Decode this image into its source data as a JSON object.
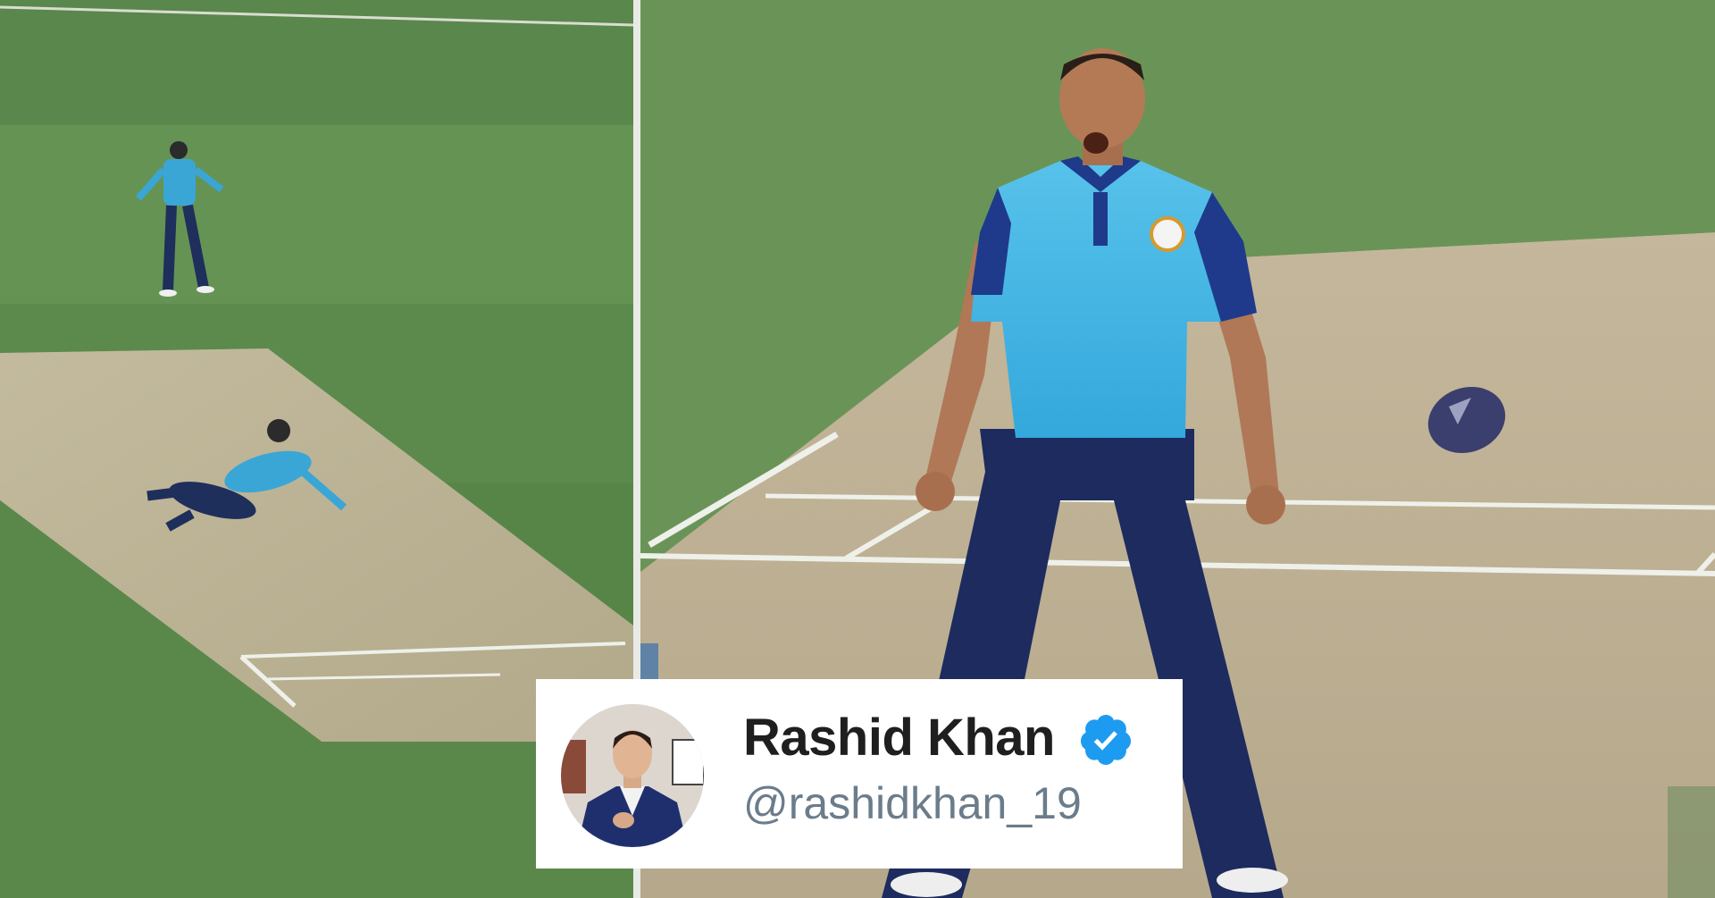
{
  "tweet_card": {
    "name": "Rashid Khan",
    "handle": "@rashidkhan_19",
    "verified": true
  },
  "colors": {
    "verified_badge": "#1d9bf0",
    "handle_text": "#6b7c8b",
    "name_text": "#1f1f1f",
    "jersey_primary": "#3fb3e0",
    "jersey_secondary": "#1f3a8a"
  },
  "icons": [
    "verified-badge-icon"
  ]
}
